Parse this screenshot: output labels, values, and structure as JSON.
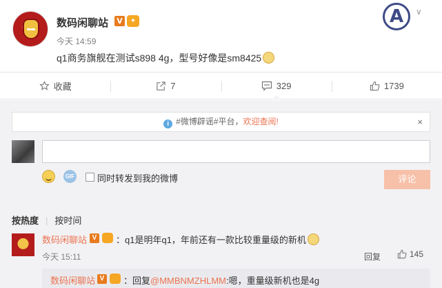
{
  "post": {
    "author": "数码闲聊站",
    "verified_badge": "V",
    "time": "今天 14:59",
    "text": "q1商务旗舰在测试s898 4g，型号好像是sm8425"
  },
  "actions": [
    {
      "icon": "star-icon",
      "label": "收藏"
    },
    {
      "icon": "share-icon",
      "label": "7"
    },
    {
      "icon": "comment-icon",
      "label": "329"
    },
    {
      "icon": "thumbs-up-icon",
      "label": "1739"
    }
  ],
  "notice": {
    "prefix": "#微博辟谣#平台，",
    "link": "欢迎查阅!",
    "close": "×"
  },
  "composer": {
    "input_value": "",
    "repost_label": "同时转发到我的微博",
    "submit_label": "评论",
    "gif_label": "GIF"
  },
  "sort": {
    "hot": "按热度",
    "time": "按时间"
  },
  "comment": {
    "author": "数码闲聊站",
    "verified_badge": "V",
    "text": "：q1是明年q1，年前还有一款比较重量级的新机",
    "time": "今天 15:11",
    "reply_label": "回复",
    "likes": "145"
  },
  "sub_reply": {
    "author": "数码闲聊站",
    "verified_badge": "V",
    "prefix": "：回复",
    "mention": "@MMBNMZHLMM",
    "text": ":嗯，重量级新机也是4g"
  },
  "colors": {
    "accent": "#eb7350",
    "verified": "#e87b1e",
    "comment_bg": "#f2f2f5",
    "submit_disabled": "#f7c0a9"
  }
}
